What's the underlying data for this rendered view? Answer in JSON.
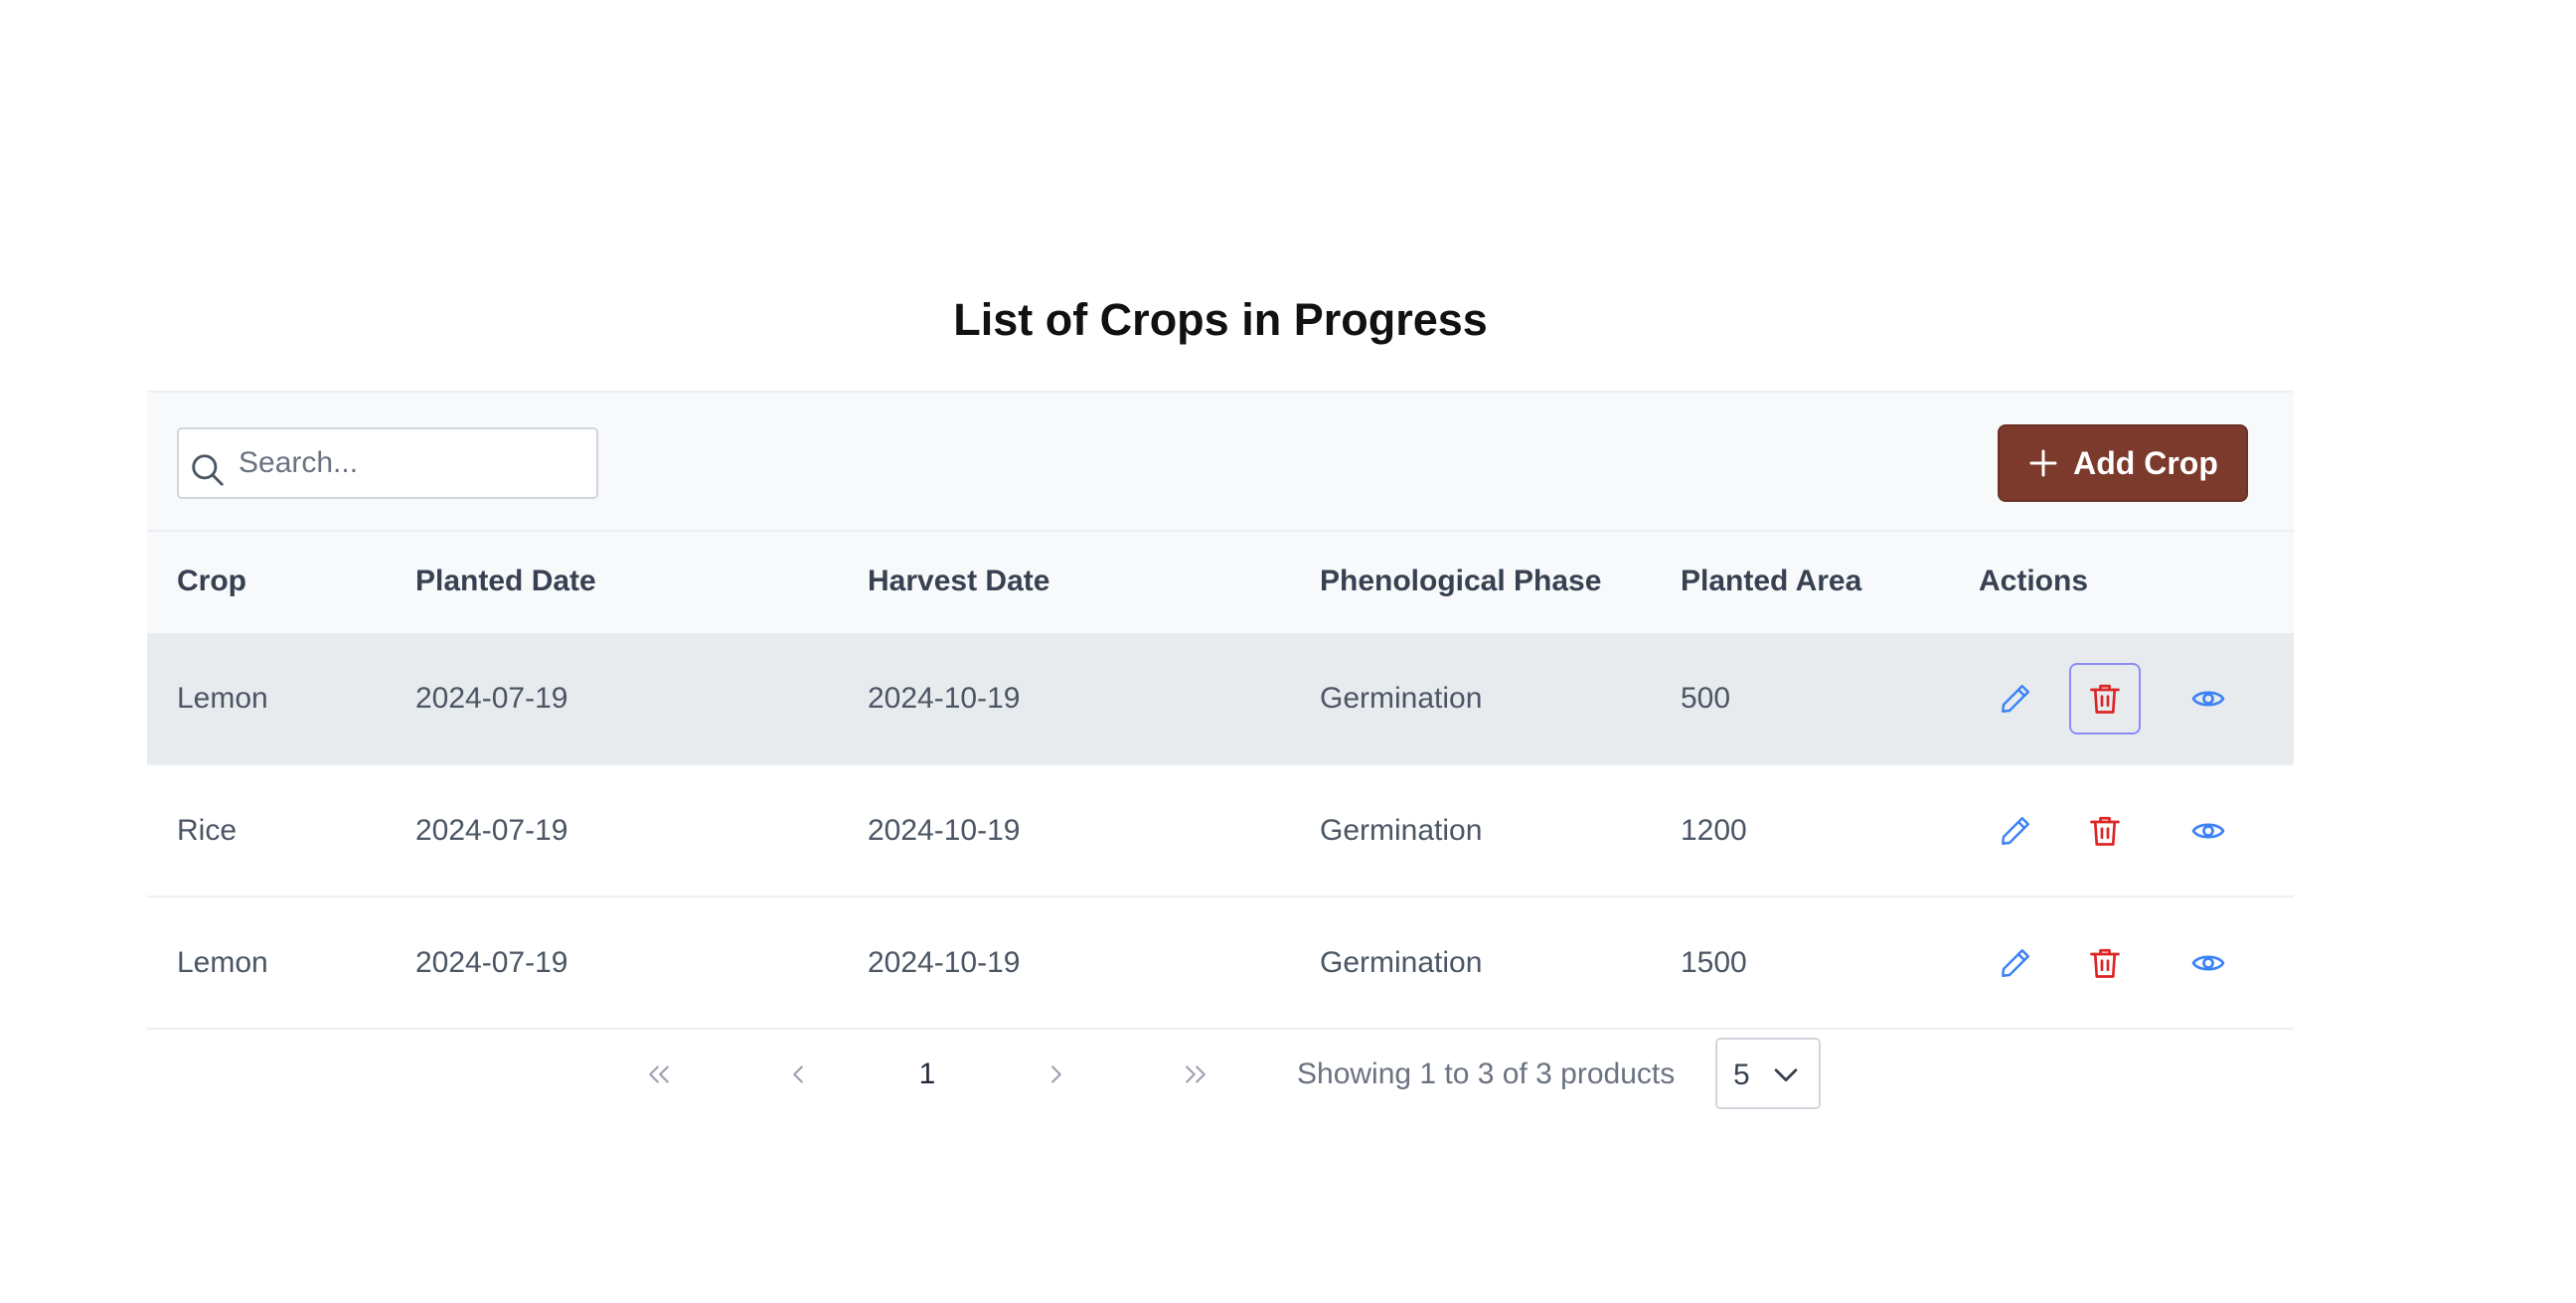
{
  "page": {
    "title": "List of Crops in Progress"
  },
  "toolbar": {
    "search_placeholder": "Search...",
    "add_button_label": "Add Crop"
  },
  "table": {
    "columns": [
      "Crop",
      "Planted Date",
      "Harvest Date",
      "Phenological Phase",
      "Planted Area",
      "Actions"
    ],
    "rows": [
      {
        "crop": "Lemon",
        "planted_date": "2024-07-19",
        "harvest_date": "2024-10-19",
        "phase": "Germination",
        "area": "500"
      },
      {
        "crop": "Rice",
        "planted_date": "2024-07-19",
        "harvest_date": "2024-10-19",
        "phase": "Germination",
        "area": "1200"
      },
      {
        "crop": "Lemon",
        "planted_date": "2024-07-19",
        "harvest_date": "2024-10-19",
        "phase": "Germination",
        "area": "1500"
      }
    ]
  },
  "pagination": {
    "current_page": "1",
    "summary": "Showing 1 to 3 of 3 products",
    "rows_per_page": "5"
  },
  "colors": {
    "accent_button": "#7b3a2c",
    "edit_icon": "#3b82f6",
    "delete_icon": "#dc2626",
    "view_icon": "#3b82f6",
    "highlight_row": "#e8ebee"
  },
  "icons": {
    "search": "search-icon",
    "add": "plus-icon",
    "edit": "pencil-icon",
    "delete": "trash-icon",
    "view": "eye-icon",
    "first": "double-chevron-left-icon",
    "prev": "chevron-left-icon",
    "next": "chevron-right-icon",
    "last": "double-chevron-right-icon",
    "select": "chevron-down-icon"
  }
}
